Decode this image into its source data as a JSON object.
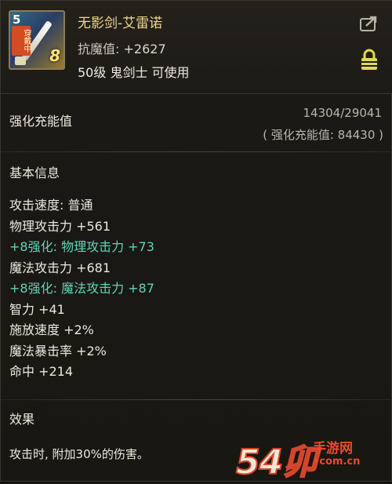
{
  "item": {
    "icon": {
      "plus_label": "5",
      "badge_text": "穿戴中",
      "enhance_level": "8",
      "name": "weapon-sword-icon"
    },
    "name": "无影剑-艾雷诺",
    "resist_label": "抗魔值:",
    "resist_value": "+2627",
    "requirement": "50级 鬼剑士 可使用"
  },
  "icons": {
    "share": "share-icon",
    "lock": "lock-icon"
  },
  "gauge": {
    "title": "强化充能值",
    "progress": "14304/29041",
    "charge_text": "( 强化充能值: 84430 )"
  },
  "basic_info": {
    "title": "基本信息",
    "lines": [
      {
        "text": "攻击速度: 普通",
        "bonus": false
      },
      {
        "text": "物理攻击力 +561",
        "bonus": false
      },
      {
        "text": "+8强化: 物理攻击力 +73",
        "bonus": true
      },
      {
        "text": "魔法攻击力 +681",
        "bonus": false
      },
      {
        "text": "+8强化: 魔法攻击力 +87",
        "bonus": true
      },
      {
        "text": "智力 +41",
        "bonus": false
      },
      {
        "text": "施放速度 +2%",
        "bonus": false
      },
      {
        "text": "魔法暴击率 +2%",
        "bonus": false
      },
      {
        "text": "命中 +214",
        "bonus": false
      }
    ]
  },
  "effect": {
    "title": "效果",
    "text": "攻击时, 附加30%的伤害。"
  },
  "watermark": {
    "main": "54卯",
    "cn": "手游网",
    "url": "•com.cn"
  },
  "colors": {
    "item_name": "#f0d98c",
    "bonus_stat": "#5fd4b8",
    "lock": "#e3d84f"
  }
}
